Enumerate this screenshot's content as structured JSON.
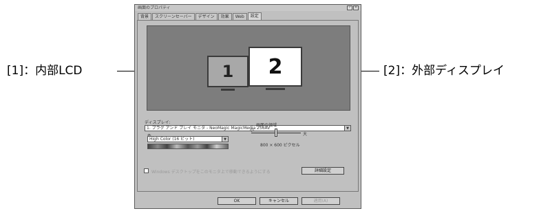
{
  "annotations": {
    "left": "[1]：内部LCD",
    "right": "[2]：外部ディスプレイ"
  },
  "dialog": {
    "title": "画面のプロパティ",
    "tabs": [
      "背景",
      "スクリーンセーバー",
      "デザイン",
      "効果",
      "Web",
      "設定"
    ],
    "monitors": [
      "1",
      "2"
    ],
    "display_label": "ディスプレイ:",
    "display_value": "1. プラグ アンド プレイ モニタ - NeoMagic MagicMedia 256AV",
    "color_label": "色",
    "color_value": "High Color (16 ビット)",
    "area_label": "画面の領域",
    "area_min": "小",
    "area_max": "大",
    "area_value": "800 × 600 ピクセル",
    "extend_desktop_label": "Windows デスクトップをこのモニタ上で移動できるようにする",
    "advanced_button": "詳細設定",
    "ok_button": "OK",
    "cancel_button": "キャンセル",
    "apply_button": "適用(A)"
  }
}
